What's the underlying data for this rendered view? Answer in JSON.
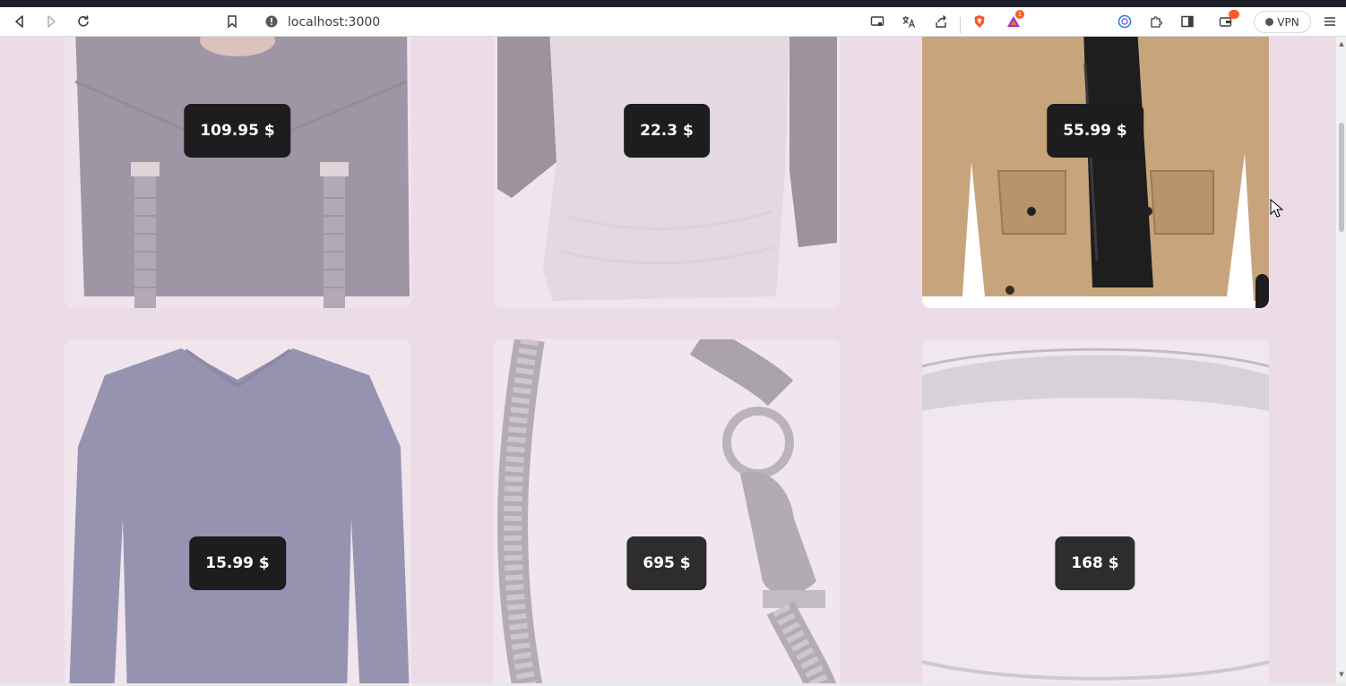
{
  "browser": {
    "url": "localhost:3000",
    "notification_count": "1",
    "vpn_label": "VPN",
    "icons": [
      "back-icon",
      "forward-icon",
      "reload-icon",
      "bookmark-icon",
      "site-info-icon",
      "cast-icon",
      "translate-icon",
      "share-icon",
      "brave-shield-icon",
      "brave-rewards-icon",
      "leo-icon",
      "extensions-icon",
      "sidebar-icon",
      "wallet-icon",
      "vpn-icon",
      "menu-icon"
    ]
  },
  "products": [
    {
      "price": "109.95 $",
      "image": "backpack",
      "dimmed": true
    },
    {
      "price": "22.3 $",
      "image": "raglan-tshirt",
      "dimmed": true
    },
    {
      "price": "55.99 $",
      "image": "khaki-jacket",
      "dimmed": false
    },
    {
      "price": "15.99 $",
      "image": "longsleeve-tee",
      "dimmed": true
    },
    {
      "price": "695 $",
      "image": "dragon-bracelet",
      "dimmed": true
    },
    {
      "price": "168 $",
      "image": "silver-ring",
      "dimmed": true
    }
  ],
  "colors": {
    "page_bg": "#ecdce7",
    "price_bg": "#1d1d1f",
    "price_text": "#ffffff"
  }
}
